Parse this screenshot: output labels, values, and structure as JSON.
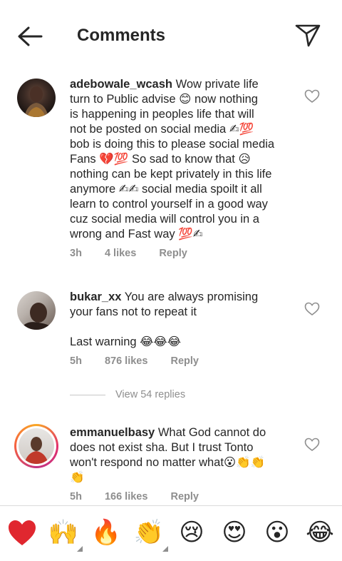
{
  "header": {
    "title": "Comments",
    "back_icon": "arrow-left-icon",
    "share_icon": "paper-plane-icon"
  },
  "comments": [
    {
      "username": "adebowale_wcash",
      "lines": [
        " Wow private life",
        "turn to Public advise 😊 now nothing",
        "is happening in peoples life that will",
        "not  be posted on social media ✍💯",
        "bob is doing this to please social media",
        "Fans 💔💯 So sad to know that 😥",
        "nothing can be kept privately in this life",
        "anymore ✍✍ social media spoilt it all",
        "learn to control yourself in a good way",
        "cuz social media will control you in a",
        "wrong and Fast way 💯✍"
      ],
      "time": "3h",
      "likes": "4 likes",
      "reply": "Reply"
    },
    {
      "username": "bukar_xx",
      "lines": [
        " You are always promising",
        "your fans not to repeat it",
        "",
        "Last warning 😂😂😂"
      ],
      "time": "5h",
      "likes": "876 likes",
      "reply": "Reply",
      "view_replies": "View 54 replies"
    },
    {
      "username": "emmanuelbasy",
      "lines": [
        " What God cannot do",
        "does not exist sha. But I trust Tonto",
        "won't respond no matter what😮👏👏",
        "👏"
      ],
      "time": "5h",
      "likes": "166 likes",
      "reply": "Reply"
    }
  ],
  "emoji_bar": [
    {
      "glyph": "❤️",
      "name": "red-heart-emoji"
    },
    {
      "glyph": "🙌",
      "name": "raising-hands-emoji",
      "has_variants": true
    },
    {
      "glyph": "🔥",
      "name": "fire-emoji"
    },
    {
      "glyph": "👏",
      "name": "clapping-hands-emoji",
      "has_variants": true
    },
    {
      "glyph": "😢",
      "name": "crying-face-emoji"
    },
    {
      "glyph": "😍",
      "name": "heart-eyes-emoji"
    },
    {
      "glyph": "😮",
      "name": "surprised-face-emoji"
    },
    {
      "glyph": "😂",
      "name": "tears-of-joy-emoji"
    }
  ],
  "colors": {
    "text": "#262626",
    "secondary": "#8e8e8e",
    "divider": "#dbdbdb",
    "heart_red": "#ed4956"
  }
}
